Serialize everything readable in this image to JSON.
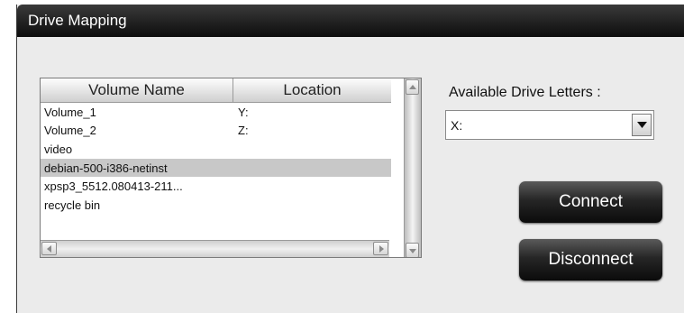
{
  "window": {
    "title": "Drive Mapping"
  },
  "list": {
    "columns": [
      "Volume Name",
      "Location"
    ],
    "rows": [
      {
        "name": "Volume_1",
        "location": "Y:"
      },
      {
        "name": "Volume_2",
        "location": "Z:"
      },
      {
        "name": "video",
        "location": ""
      },
      {
        "name": "debian-500-i386-netinst",
        "location": ""
      },
      {
        "name": "xpsp3_5512.080413-211...",
        "location": ""
      },
      {
        "name": "recycle bin",
        "location": ""
      }
    ],
    "selected_row": "debian-500-i386-netinst"
  },
  "drive": {
    "label": "Available Drive Letters :",
    "selected": "X:"
  },
  "buttons": {
    "connect": "Connect",
    "disconnect": "Disconnect"
  },
  "icons": [
    "up-arrow-icon",
    "down-arrow-icon",
    "left-arrow-icon",
    "right-arrow-icon",
    "dropdown-arrow-icon"
  ]
}
